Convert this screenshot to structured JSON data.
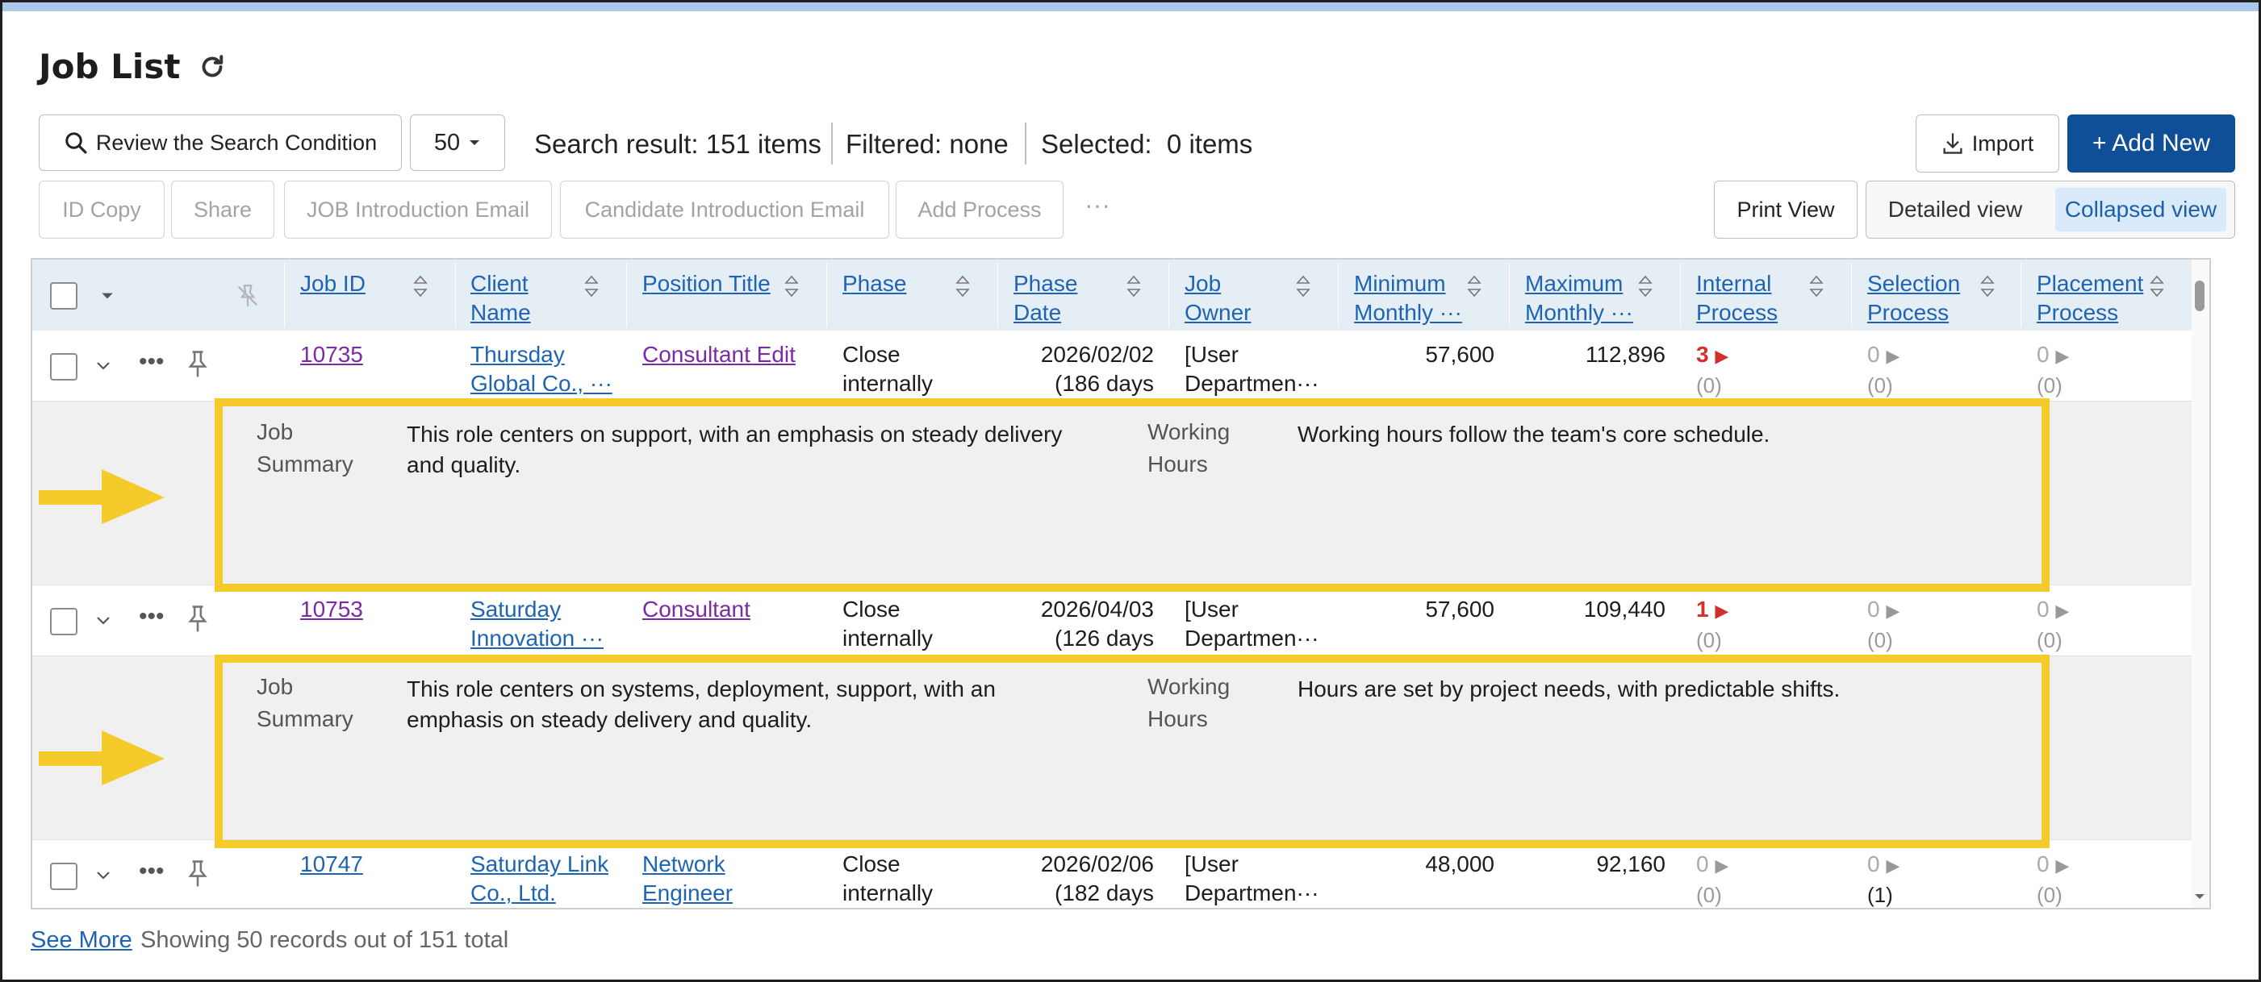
{
  "header": {
    "title": "Job List"
  },
  "toolbar": {
    "review_label": "Review the Search Condition",
    "page_size": "50",
    "search_result": "Search result: 151 items",
    "filtered": "Filtered: none",
    "selected": "Selected:  0 items",
    "import_label": "Import",
    "add_new_label": "+ Add New",
    "actions": [
      "ID Copy",
      "Share",
      "JOB Introduction Email",
      "Candidate Introduction Email",
      "Add Process"
    ],
    "more": "···",
    "print_view": "Print View",
    "view_modes": [
      "Detailed view",
      "Collapsed view"
    ],
    "active_view": "Collapsed view"
  },
  "table": {
    "columns": [
      [
        "Job ID"
      ],
      [
        "Client ",
        "Name"
      ],
      [
        "Position Title"
      ],
      [
        "Phase"
      ],
      [
        "Phase ",
        "Date"
      ],
      [
        "Job ",
        "Owner"
      ],
      [
        "Minimum ",
        "Monthly ···"
      ],
      [
        "Maximum ",
        "Monthly ···"
      ],
      [
        "Internal ",
        "Process"
      ],
      [
        "Selection ",
        "Process"
      ],
      [
        "Placement ",
        "Process"
      ]
    ],
    "rows": [
      {
        "job_id": "10735",
        "client": [
          "Thursday ",
          "Global Co., ···"
        ],
        "position": "Consultant Edit",
        "phase": [
          "Close",
          "internally"
        ],
        "phase_date": [
          "2026/02/02",
          "(186 days"
        ],
        "owner": [
          "[User",
          "Departmen···"
        ],
        "min_monthly": "57,600",
        "max_monthly": "112,896",
        "internal": "3",
        "internal_sub": "(0)",
        "selection": "0",
        "selection_sub": "(0)",
        "placement": "0",
        "placement_sub": "(0)",
        "detail": {
          "summary_label": [
            "Job",
            "Summary"
          ],
          "summary": [
            "This role centers on support, with an emphasis on steady delivery",
            "and quality."
          ],
          "hours_label": [
            "Working",
            "Hours"
          ],
          "hours": "Working hours follow the team's core schedule."
        }
      },
      {
        "job_id": "10753",
        "client": [
          "Saturday ",
          "Innovation ···"
        ],
        "position": "Consultant",
        "phase": [
          "Close",
          "internally"
        ],
        "phase_date": [
          "2026/04/03",
          "(126 days"
        ],
        "owner": [
          "[User",
          "Departmen···"
        ],
        "min_monthly": "57,600",
        "max_monthly": "109,440",
        "internal": "1",
        "internal_sub": "(0)",
        "selection": "0",
        "selection_sub": "(0)",
        "placement": "0",
        "placement_sub": "(0)",
        "detail": {
          "summary_label": [
            "Job",
            "Summary"
          ],
          "summary": [
            "This role centers on systems, deployment, support, with an",
            "emphasis on steady delivery and quality."
          ],
          "hours_label": [
            "Working",
            "Hours"
          ],
          "hours": "Hours are set by project needs, with predictable shifts."
        }
      },
      {
        "job_id": "10747",
        "client": [
          "Saturday Link",
          "Co., Ltd."
        ],
        "position": [
          "Network ",
          "Engineer"
        ],
        "phase": [
          "Close",
          "internally"
        ],
        "phase_date": [
          "2026/02/06",
          "(182 days"
        ],
        "owner": [
          "[User",
          "Departmen···"
        ],
        "min_monthly": "48,000",
        "max_monthly": "92,160",
        "internal": "0",
        "internal_sub": "(0)",
        "selection": "0",
        "selection_sub": "(1)",
        "placement": "0",
        "placement_sub": "(0)"
      }
    ]
  },
  "footer": {
    "see_more": "See More",
    "showing": "Showing 50 records out of 151 total"
  },
  "colors": {
    "primary": "#0f4f98",
    "link": "#1e64b4",
    "visited_link": "#7b2aa6",
    "highlight": "#f4cb2a",
    "alert": "#d32f2f"
  }
}
